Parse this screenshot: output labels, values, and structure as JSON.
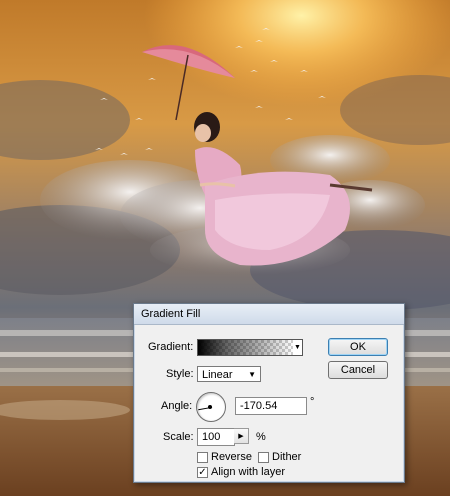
{
  "dialog": {
    "title": "Gradient Fill",
    "gradient_label": "Gradient:",
    "style_label": "Style:",
    "style_value": "Linear",
    "angle_label": "Angle:",
    "angle_value": "-170.54",
    "degree_symbol": "°",
    "scale_label": "Scale:",
    "scale_value": "100",
    "scale_unit": "%",
    "reverse_label": "Reverse",
    "reverse_checked": false,
    "dither_label": "Dither",
    "dither_checked": false,
    "align_label": "Align with layer",
    "align_checked": true,
    "ok_label": "OK",
    "cancel_label": "Cancel"
  },
  "colors": {
    "sky_top": "#c9862f",
    "sun_glow": "#ffd36a",
    "cloud": "#e9e6e4",
    "sea": "#6f7680",
    "sand": "#8a5a2e",
    "dress": "#e6aac4",
    "umbrella": "#d8687c"
  },
  "icons": {
    "dropdown": "chevron-down-icon",
    "stepper": "chevron-right-icon",
    "checkmark": "check-icon"
  }
}
